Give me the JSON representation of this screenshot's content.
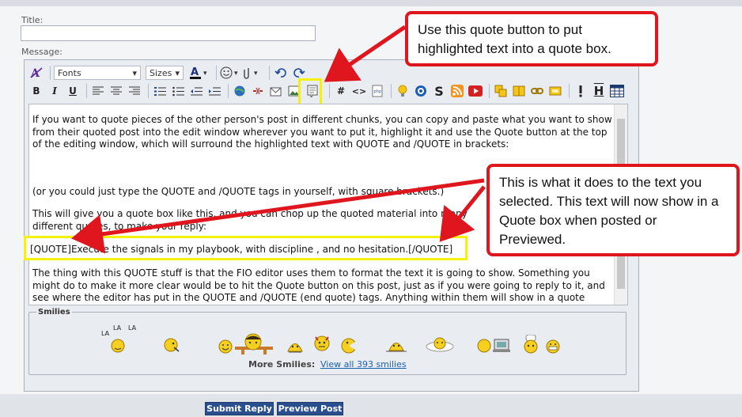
{
  "form": {
    "title_label": "Title:",
    "message_label": "Message:"
  },
  "toolbar": {
    "font_select": "Fonts",
    "size_select": "Sizes",
    "bold": "B",
    "italic": "I",
    "underline": "U",
    "hash": "#",
    "code": "<>",
    "s_icon": "S",
    "h_icon": "H"
  },
  "editor": {
    "paragraph1": "If you want to quote pieces of the other person's post in different chunks, you can copy and paste what you want to show from their quoted post into the edit window wherever you want to put it, highlight it and use the Quote button at the top of the editing window, which will surround the highlighted text with QUOTE and /QUOTE in brackets:",
    "paragraph2": "(or you could just type the QUOTE and /QUOTE tags in yourself, with square brackets.)",
    "paragraph3": "This will give you a quote box like this, and you can chop up the quoted material into many different quotes, to make your reply:",
    "quote_line": "[QUOTE]Execute the signals in my playbook, with discipline , and no hesitation.[/QUOTE]",
    "paragraph4": "The thing with this QUOTE stuff is that the FIO editor uses them to format the text it is going to show. Something you might do to make it more clear would be to hit the Quote button on this post, just as if you were going to reply to it, and see where the editor has put in the QUOTE and /QUOTE (end quote) tags. Anything within them will show in a quote"
  },
  "smilies": {
    "legend": "Smilies",
    "more_label": "More Smilies:",
    "more_link": "View all 393 smilies",
    "la_text": [
      "LA",
      "LA",
      "LA"
    ]
  },
  "actions": {
    "submit": "Submit Reply",
    "preview": "Preview Post"
  },
  "callouts": {
    "top": "Use this quote button to put highlighted text into a quote box.",
    "right": "This is what it does to the text you selected. This text will now show in a Quote box when posted or Previewed."
  },
  "colors": {
    "accent_red": "#e0161f",
    "highlight_yellow": "#f4f20a",
    "button_blue": "#2a4f8f"
  }
}
